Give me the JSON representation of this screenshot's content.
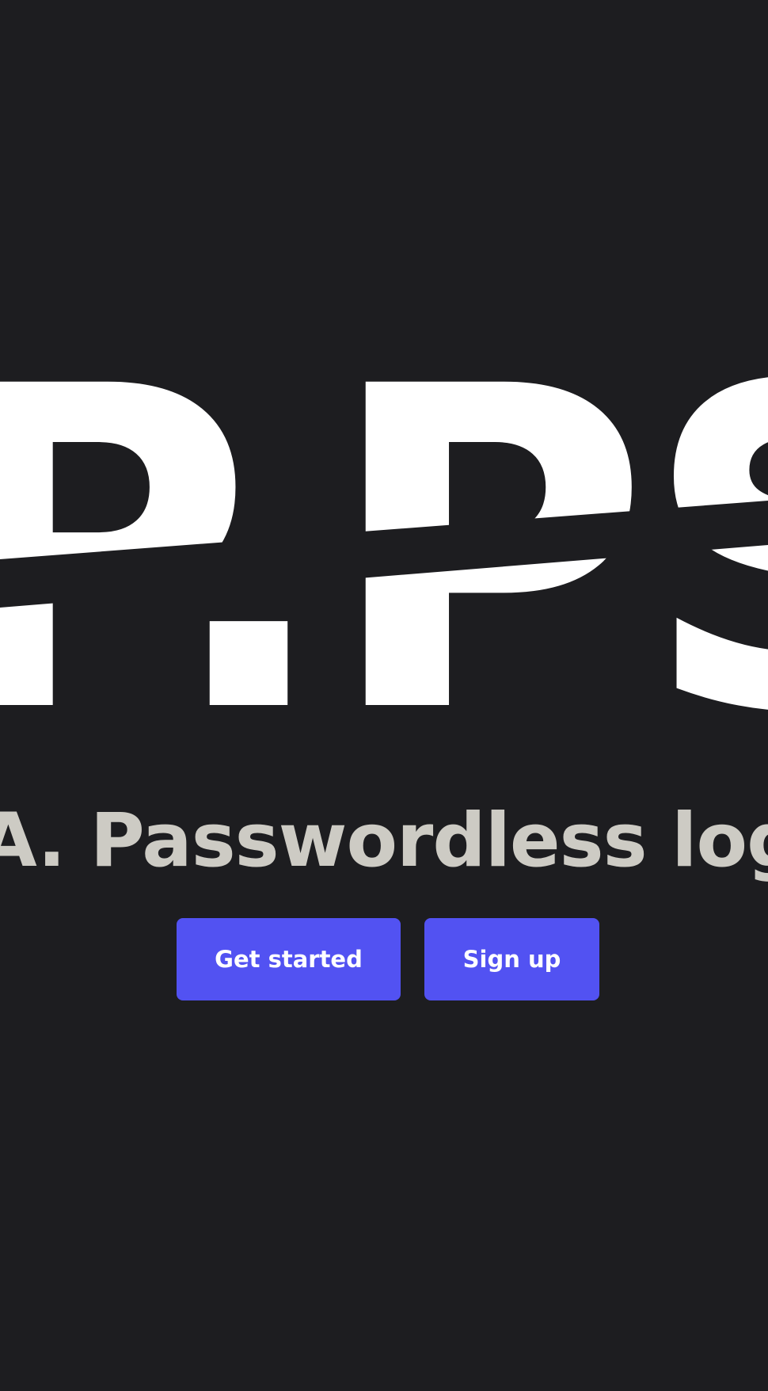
{
  "hero": {
    "logo_text": "P.PSW",
    "tagline": "A. Passwordless login",
    "buttons": {
      "get_started": "Get started",
      "sign_up": "Sign up"
    }
  },
  "colors": {
    "background": "#1d1d20",
    "logo": "#ffffff",
    "tagline": "#cdcbc4",
    "button": "#5252f2",
    "button_text": "#ffffff"
  }
}
